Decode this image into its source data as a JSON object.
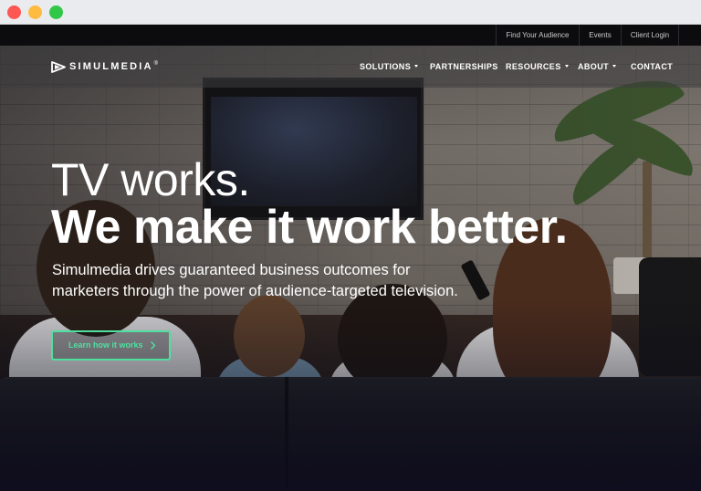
{
  "browser": {
    "traffic_lights": [
      "#fc5753",
      "#fdbc40",
      "#33c748"
    ]
  },
  "utility_nav": {
    "find_audience": "Find Your Audience",
    "events": "Events",
    "client_login": "Client Login"
  },
  "brand": {
    "logo_text": "SIMULMEDIA",
    "logo_mark": "®"
  },
  "main_nav": {
    "solutions": "SOLUTIONS",
    "partnerships": "PARTNERSHIPS",
    "resources": "RESOURCES",
    "about": "ABOUT",
    "contact": "CONTACT"
  },
  "hero": {
    "headline_1": "TV works.",
    "headline_2": "We make it work better.",
    "subtext": "Simulmedia drives guaranteed business outcomes for marketers through the power of audience-targeted television.",
    "cta_label": "Learn how it works"
  },
  "colors": {
    "accent": "#4fe0a0",
    "topbar": "#0c0c0e"
  },
  "icons": {
    "logo": "play-logo-icon",
    "dropdown": "caret-down-icon",
    "cta": "chevron-right-icon"
  }
}
